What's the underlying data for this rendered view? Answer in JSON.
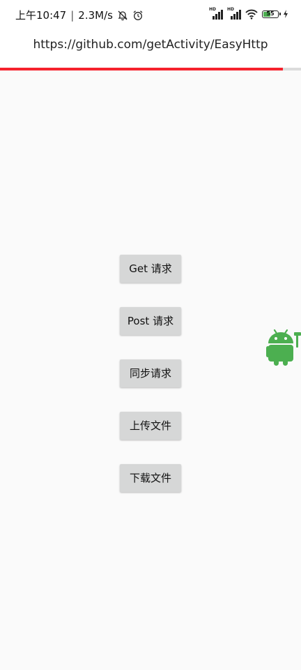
{
  "status_bar": {
    "time": "上午10:47",
    "separator": "|",
    "net_speed": "2.3M/s",
    "battery_level": "55",
    "battery_fraction": 0.55,
    "icons": [
      "mute-icon",
      "alarm-icon",
      "hd-signal-icon",
      "hd-signal-icon",
      "wifi-icon",
      "battery-icon",
      "charging-icon"
    ]
  },
  "toolbar": {
    "title": "https://github.com/getActivity/EasyHttp"
  },
  "progress": {
    "fraction": 0.94,
    "color": "#f5222d"
  },
  "buttons": [
    {
      "id": "get",
      "label": "Get 请求"
    },
    {
      "id": "post",
      "label": "Post 请求"
    },
    {
      "id": "sync",
      "label": "同步请求"
    },
    {
      "id": "upload",
      "label": "上传文件"
    },
    {
      "id": "download",
      "label": "下载文件"
    }
  ],
  "floating": {
    "icon": "android-robot-icon",
    "color": "#4caf50"
  }
}
